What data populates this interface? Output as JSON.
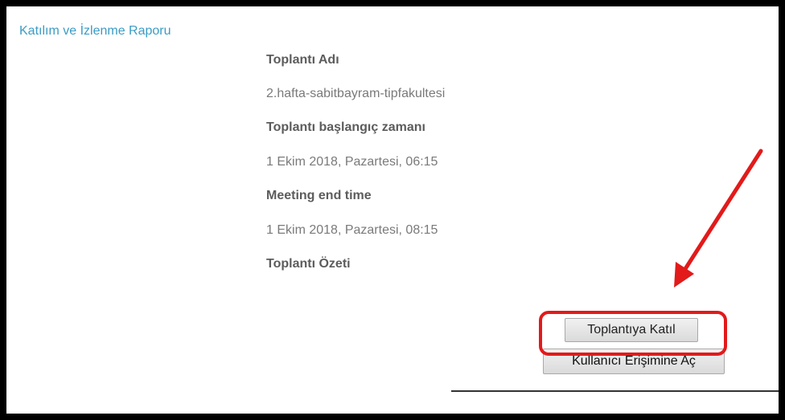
{
  "page": {
    "report_link": "Katılım ve İzlenme Raporu"
  },
  "meeting": {
    "name_label": "Toplantı Adı",
    "name_value": "2.hafta-sabitbayram-tipfakultesi",
    "start_label": "Toplantı başlangıç zamanı",
    "start_value": "1 Ekim 2018, Pazartesi, 06:15",
    "end_label": "Meeting end time",
    "end_value": "1 Ekim 2018, Pazartesi, 08:15",
    "summary_label": "Toplantı Özeti"
  },
  "actions": {
    "join_label": "Toplantıya Katıl",
    "access_label": "Kullanıcı Erişimine Aç"
  },
  "colors": {
    "link": "#3b9cc5",
    "annotation": "#e21a1a"
  },
  "icons": {
    "annotation": "red-arrow-icon"
  }
}
